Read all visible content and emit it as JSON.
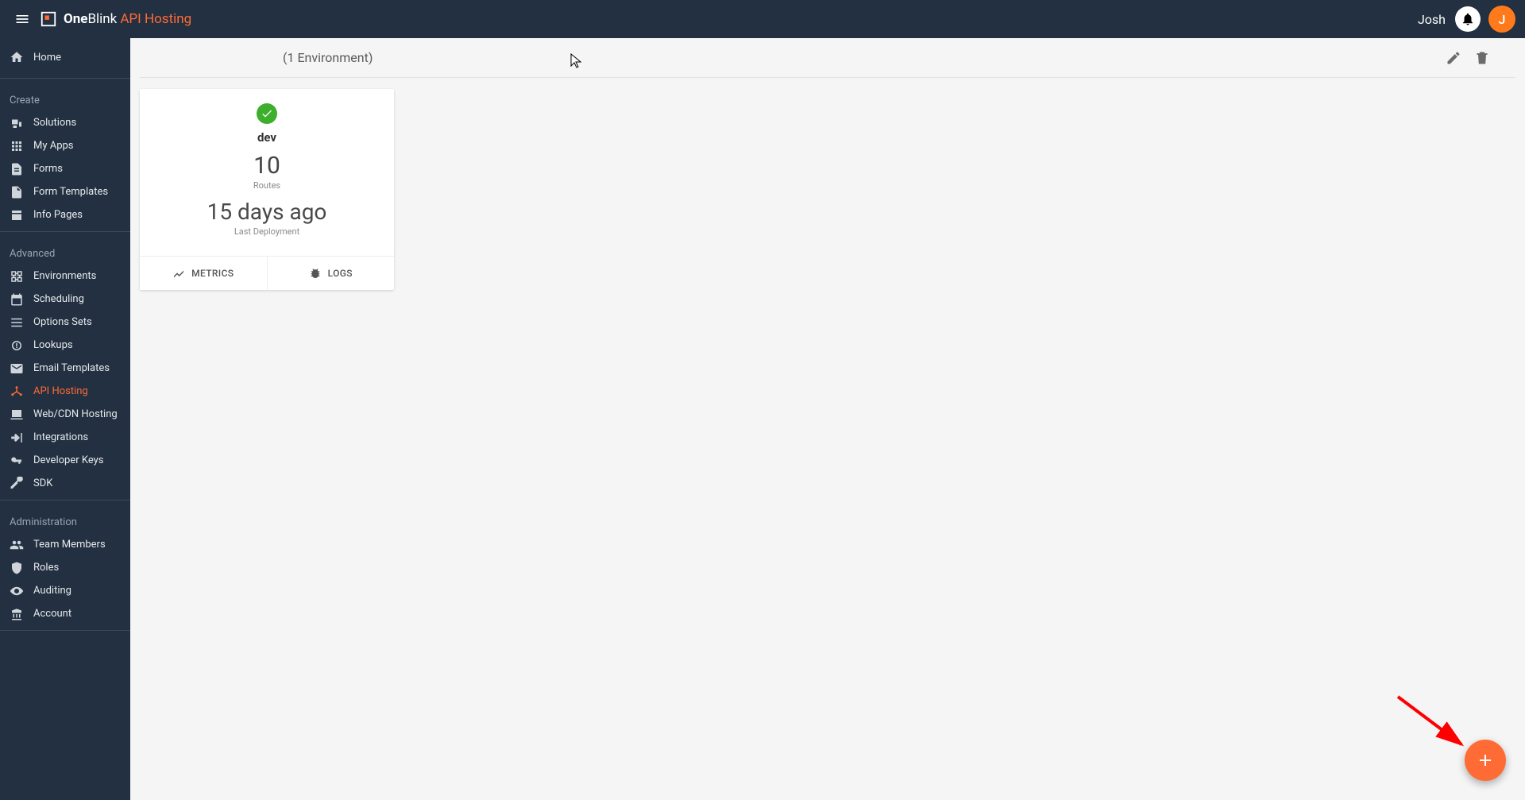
{
  "header": {
    "brand_bold": "One",
    "brand_reg": "Blink",
    "section": "API Hosting",
    "user_name": "Josh",
    "avatar_initial": "J"
  },
  "sidebar": {
    "home": "Home",
    "groups": [
      {
        "label": "Create",
        "items": [
          {
            "icon": "solutions",
            "label": "Solutions"
          },
          {
            "icon": "apps",
            "label": "My Apps"
          },
          {
            "icon": "forms",
            "label": "Forms"
          },
          {
            "icon": "templates",
            "label": "Form Templates"
          },
          {
            "icon": "infopages",
            "label": "Info Pages"
          }
        ]
      },
      {
        "label": "Advanced",
        "items": [
          {
            "icon": "environments",
            "label": "Environments"
          },
          {
            "icon": "scheduling",
            "label": "Scheduling"
          },
          {
            "icon": "options",
            "label": "Options Sets"
          },
          {
            "icon": "lookups",
            "label": "Lookups"
          },
          {
            "icon": "email",
            "label": "Email Templates"
          },
          {
            "icon": "api",
            "label": "API Hosting",
            "active": true
          },
          {
            "icon": "web",
            "label": "Web/CDN Hosting"
          },
          {
            "icon": "integrations",
            "label": "Integrations"
          },
          {
            "icon": "keys",
            "label": "Developer Keys"
          },
          {
            "icon": "sdk",
            "label": "SDK"
          }
        ]
      },
      {
        "label": "Administration",
        "items": [
          {
            "icon": "team",
            "label": "Team Members"
          },
          {
            "icon": "roles",
            "label": "Roles"
          },
          {
            "icon": "auditing",
            "label": "Auditing"
          },
          {
            "icon": "account",
            "label": "Account"
          }
        ]
      }
    ]
  },
  "content": {
    "page_subtitle": "(1 Environment)"
  },
  "env_card": {
    "name": "dev",
    "routes_count": "10",
    "routes_label": "Routes",
    "last_deploy": "15 days ago",
    "last_deploy_label": "Last Deployment",
    "metrics_label": "METRICS",
    "logs_label": "LOGS"
  },
  "colors": {
    "accent": "#ff6b35",
    "sidebar_bg": "#223041",
    "success": "#3daf2c"
  }
}
